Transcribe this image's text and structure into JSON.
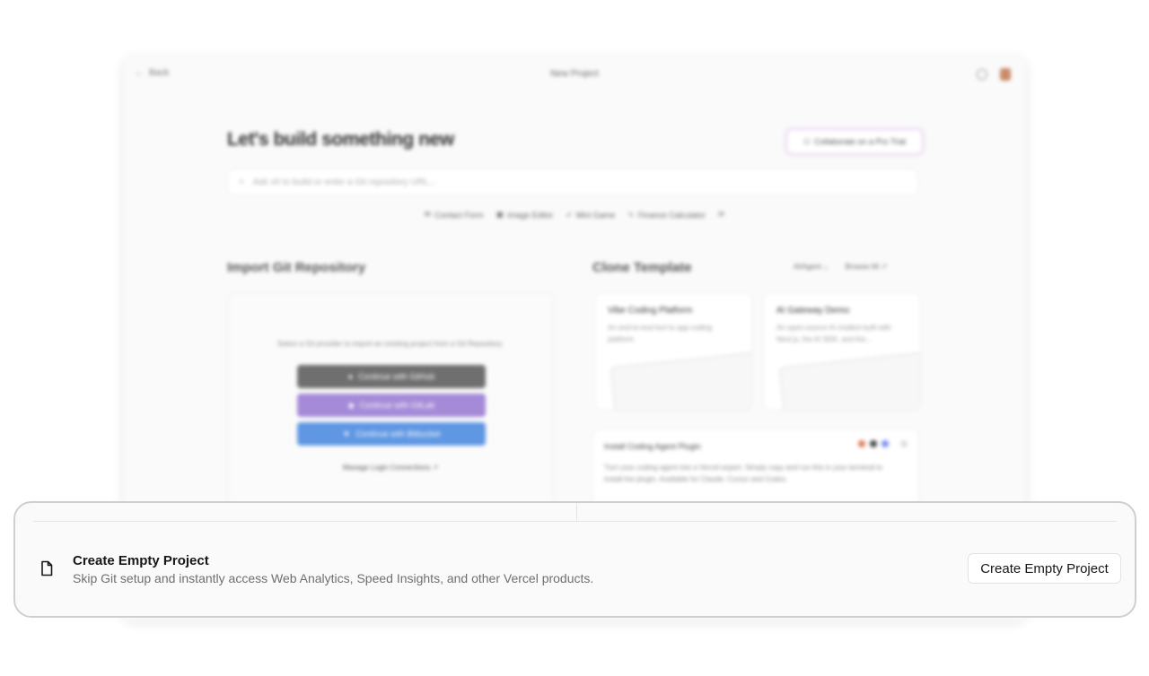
{
  "topbar": {
    "back_label": "Back",
    "title": "New Project"
  },
  "hero": {
    "headline": "Let's build something new",
    "trial_button": "Collaborate on a Pro Trial",
    "prompt_placeholder": "Ask v0 to build or enter a Git repository URL..."
  },
  "suggestions": [
    "Contact Form",
    "Image Editor",
    "Mini Game",
    "Finance Calculator"
  ],
  "import_git": {
    "title": "Import Git Repository",
    "description": "Select a Git provider to import an existing project from a Git Repository.",
    "github": "Continue with GitHub",
    "gitlab": "Continue with GitLab",
    "bitbucket": "Continue with Bitbucket",
    "manage": "Manage Login Connections"
  },
  "clone_template": {
    "title": "Clone Template",
    "filter": "AI/Agent",
    "browse": "Browse All",
    "cards": [
      {
        "title": "Vibe Coding Platform",
        "desc": "An end-to-end text to app coding platform"
      },
      {
        "title": "AI Gateway Demo",
        "desc": "An open-source AI chatbot built with Next.js, the AI SDK, and the..."
      }
    ]
  },
  "plugin": {
    "title": "Install Coding Agent Plugin",
    "desc": "Turn your coding agent into a Vercel expert. Simply copy and run this in your terminal to install the plugin. Available for Claude, Cursor and Codex."
  },
  "empty_project": {
    "title": "Create Empty Project",
    "description": "Skip Git setup and instantly access Web Analytics, Speed Insights, and other Vercel products.",
    "button": "Create Empty Project"
  },
  "colors": {
    "github": "#6f6f6f",
    "gitlab": "#a58ad8",
    "bitbucket": "#5f97e3",
    "background": "#fafafa"
  }
}
